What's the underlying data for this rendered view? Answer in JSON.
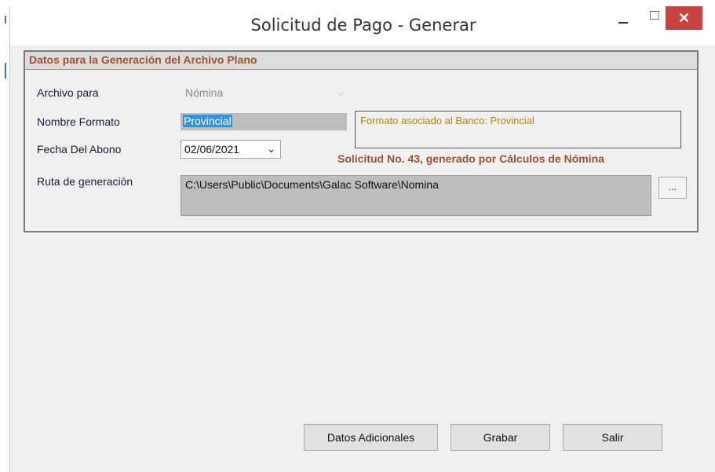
{
  "window": {
    "title": "Solicitud de Pago - Generar",
    "close_glyph": "✕"
  },
  "group": {
    "header": "Datos para la Generación del Archivo Plano",
    "archivo_para": {
      "label": "Archivo para",
      "value": "Nómina"
    },
    "nombre_formato": {
      "label": "Nombre Formato",
      "value": "Provincial"
    },
    "formato_info": "Formato asociado al Banco: Provincial",
    "fecha_abono": {
      "label": "Fecha Del Abono",
      "value": "02/06/2021"
    },
    "solicitud_text": "Solicitud No. 43, generado por Cálculos de Nómina",
    "ruta": {
      "label": "Ruta de generación",
      "value": "C:\\Users\\Public\\Documents\\Galac Software\\Nomina",
      "browse_label": "..."
    }
  },
  "buttons": {
    "datos_adicionales": "Datos Adicionales",
    "grabar": "Grabar",
    "salir": "Salir"
  },
  "colors": {
    "accent_brown": "#a0522d",
    "info_gold": "#b8860b",
    "close_red": "#c74340",
    "selection_blue": "#3393df"
  }
}
